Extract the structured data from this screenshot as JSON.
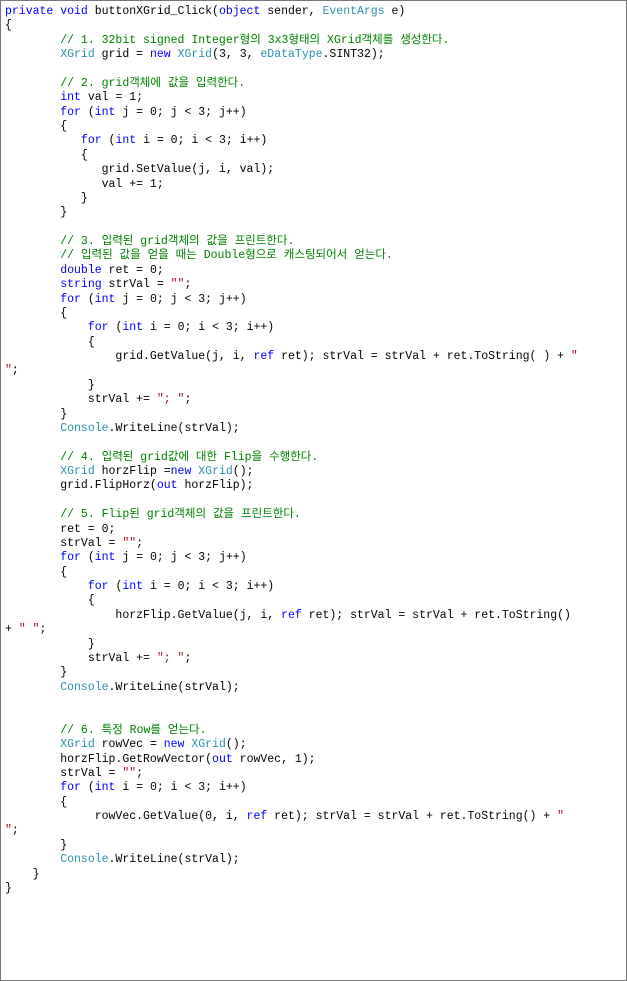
{
  "code": {
    "line01": {
      "kw1": "private",
      "kw2": "void",
      "fn": " buttonXGrid_Click(",
      "kw3": "object",
      "mid": " sender, ",
      "type": "EventArgs",
      "end": " e)"
    },
    "line02": "{",
    "c1": "        // 1. 32bit signed Integer형의 3x3형태의 XGrid객체를 생성한다.",
    "l1a": {
      "pre": "        ",
      "type": "XGrid",
      "mid": " grid = ",
      "kw": "new",
      "rest": " ",
      "type2": "XGrid",
      "paren": "(3, 3, ",
      "enum": "eDataType",
      "end": ".SINT32);"
    },
    "c2": "        // 2. grid객체에 값을 입력한다.",
    "l2a": {
      "pre": "        ",
      "kw": "int",
      "rest": " val = 1;"
    },
    "l2b": {
      "pre": "        ",
      "kw": "for",
      "open": " (",
      "kw2": "int",
      "rest": " j = 0; j < 3; j++)"
    },
    "l2c": "        {",
    "l2d": {
      "pre": "           ",
      "kw": "for",
      "open": " (",
      "kw2": "int",
      "rest": " i = 0; i < 3; i++)"
    },
    "l2e": "           {",
    "l2f": "              grid.SetValue(j, i, val);",
    "l2g": "              val += 1;",
    "l2h": "           }",
    "l2i": "        }",
    "c3a": "        // 3. 입력된 grid객체의 값을 프린트한다.",
    "c3b": "        // 입력된 값을 얻을 때는 Double형으로 캐스팅되어서 얻는다.",
    "l3a": {
      "pre": "        ",
      "kw": "double",
      "rest": " ret = 0;"
    },
    "l3b": {
      "pre": "        ",
      "kw": "string",
      "rest": " strVal = ",
      "str": "\"\"",
      "end": ";"
    },
    "l3c": {
      "pre": "        ",
      "kw": "for",
      "open": " (",
      "kw2": "int",
      "rest": " j = 0; j < 3; j++)"
    },
    "l3d": "        {",
    "l3e": {
      "pre": "            ",
      "kw": "for",
      "open": " (",
      "kw2": "int",
      "rest": " i = 0; i < 3; i++)"
    },
    "l3f": "            {",
    "l3g": {
      "pre": "                grid.GetValue(j, i, ",
      "kw": "ref",
      "mid": " ret); strVal = strVal + ret.ToString( ) + ",
      "str": "\" \n\"",
      "end": ";"
    },
    "l3g_a": "                grid.GetValue(j, i, ",
    "l3g_kw": "ref",
    "l3g_b": " ret); strVal = strVal + ret.ToString( ) + ",
    "l3g_s": "\" ",
    "l3g_c": "\"",
    "l3g_d": ";",
    "l3h": "            }",
    "l3i": {
      "pre": "            strVal += ",
      "str": "\"; \"",
      "end": ";"
    },
    "l3j": "        }",
    "l3k": {
      "pre": "        ",
      "type": "Console",
      "rest": ".WriteLine(strVal);"
    },
    "c4": "        // 4. 입력된 grid값에 대한 Flip을 수행한다.",
    "l4a": {
      "pre": "        ",
      "type": "XGrid",
      "mid": " horzFlip =",
      "kw": "new",
      "sp": " ",
      "type2": "XGrid",
      "end": "();"
    },
    "l4b": {
      "pre": "        grid.FlipHorz(",
      "kw": "out",
      "rest": " horzFlip);"
    },
    "c5": "        // 5. Flip된 grid객체의 값을 프린트한다.",
    "l5a": "        ret = 0;",
    "l5b": {
      "pre": "        strVal = ",
      "str": "\"\"",
      "end": ";"
    },
    "l5c": {
      "pre": "        ",
      "kw": "for",
      "open": " (",
      "kw2": "int",
      "rest": " j = 0; j < 3; j++)"
    },
    "l5d": "        {",
    "l5e": {
      "pre": "            ",
      "kw": "for",
      "open": " (",
      "kw2": "int",
      "rest": " i = 0; i < 3; i++)"
    },
    "l5f": "            {",
    "l5g_a": "                horzFlip.GetValue(j, i, ",
    "l5g_kw": "ref",
    "l5g_b": " ret); strVal = strVal + ret.ToString() ",
    "l5g_c": "+ ",
    "l5g_s": "\" \"",
    "l5g_d": ";",
    "l5h": "            }",
    "l5i": {
      "pre": "            strVal += ",
      "str": "\"; \"",
      "end": ";"
    },
    "l5j": "        }",
    "l5k": {
      "pre": "        ",
      "type": "Console",
      "rest": ".WriteLine(strVal);"
    },
    "c6": "        // 6. 특정 Row를 얻는다.",
    "l6a": {
      "pre": "        ",
      "type": "XGrid",
      "mid": " rowVec = ",
      "kw": "new",
      "sp": " ",
      "type2": "XGrid",
      "end": "();"
    },
    "l6b": {
      "pre": "        horzFlip.GetRowVector(",
      "kw": "out",
      "rest": " rowVec, 1);"
    },
    "l6c": {
      "pre": "        strVal = ",
      "str": "\"\"",
      "end": ";"
    },
    "l6d": {
      "pre": "        ",
      "kw": "for",
      "open": " (",
      "kw2": "int",
      "rest": " i = 0; i < 3; i++)"
    },
    "l6e": "        {",
    "l6f_a": "             rowVec.GetValue(0, i, ",
    "l6f_kw": "ref",
    "l6f_b": " ret); strVal = strVal + ret.ToString() + ",
    "l6f_s": "\" ",
    "l6f_c": "\"",
    "l6f_d": ";",
    "l6g": "        }",
    "l6h": {
      "pre": "        ",
      "type": "Console",
      "rest": ".WriteLine(strVal);"
    },
    "l6i": "    }",
    "l6j": "}"
  }
}
